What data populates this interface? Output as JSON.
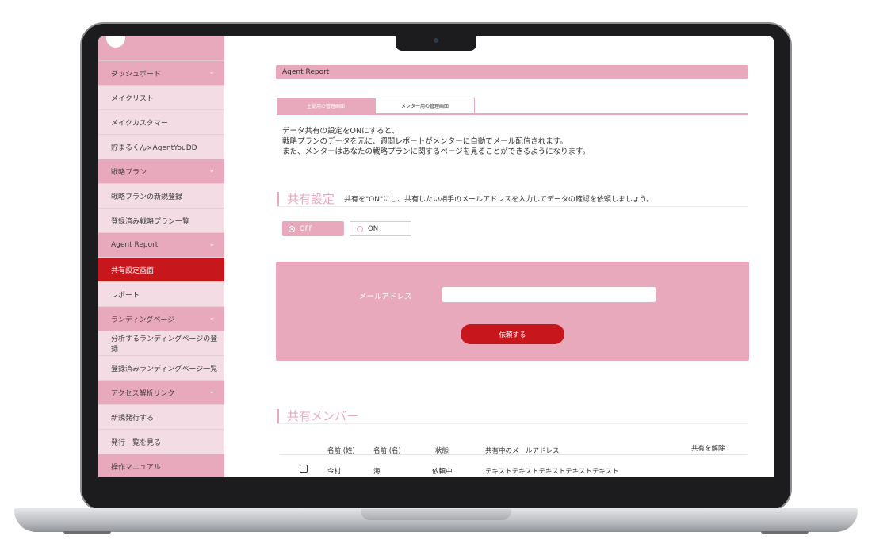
{
  "sidebar": {
    "items": [
      {
        "label": "ダッシュボード",
        "type": "cat"
      },
      {
        "label": "メイクリスト",
        "type": "sub"
      },
      {
        "label": "メイクカスタマー",
        "type": "sub"
      },
      {
        "label": "貯まるくん×AgentYouDD",
        "type": "sub"
      },
      {
        "label": "戦略プラン",
        "type": "cat"
      },
      {
        "label": "戦略プランの新規登録",
        "type": "sub"
      },
      {
        "label": "登録済み戦略プラン一覧",
        "type": "sub"
      },
      {
        "label": "Agent  Report",
        "type": "cat"
      },
      {
        "label": "共有設定画面",
        "type": "active"
      },
      {
        "label": "レポート",
        "type": "sub"
      },
      {
        "label": "ランディングページ",
        "type": "cat"
      },
      {
        "label": "分析するランディングページの登録",
        "type": "sub"
      },
      {
        "label": "登録済みランディングページ一覧",
        "type": "sub"
      },
      {
        "label": "アクセス解析リンク",
        "type": "cat"
      },
      {
        "label": "新規発行する",
        "type": "sub"
      },
      {
        "label": "発行一覧を見る",
        "type": "sub"
      },
      {
        "label": "操作マニュアル",
        "type": "cat-nochev"
      }
    ]
  },
  "header": {
    "title": "Agent Report"
  },
  "tabs": [
    {
      "label": "主従用の管理画面",
      "active": true
    },
    {
      "label": "メンター用の管理画面",
      "active": false
    }
  ],
  "description": [
    "データ共有の設定をONにすると、",
    "戦略プランのデータを元に、週間レポートがメンターに自動でメール配信されます。",
    "また、メンターはあなたの戦略プランに関するページを見ることができるようになります。"
  ],
  "sharing": {
    "title": "共有設定",
    "hint": "共有を\"ON\"にし、共有したい相手のメールアドレスを入力してデータの確認を依頼しましょう。",
    "off_label": "OFF",
    "on_label": "ON",
    "selected": "OFF"
  },
  "request_form": {
    "email_label": "メールアドレス",
    "email_value": "",
    "submit_label": "依頼する"
  },
  "members": {
    "title": "共有メンバー",
    "columns": [
      "名前 (姓)",
      "名前 (名)",
      "状態",
      "共有中のメールアドレス",
      "共有を解除"
    ],
    "rows": [
      {
        "last_name": "今村",
        "first_name": "海",
        "status": "依頼中",
        "email": "テキストテキストテキストテキストテキスト"
      }
    ]
  },
  "colors": {
    "accent_pink": "#e8a9bc",
    "light_pink": "#f3dce4",
    "brand_red": "#c8161d"
  }
}
